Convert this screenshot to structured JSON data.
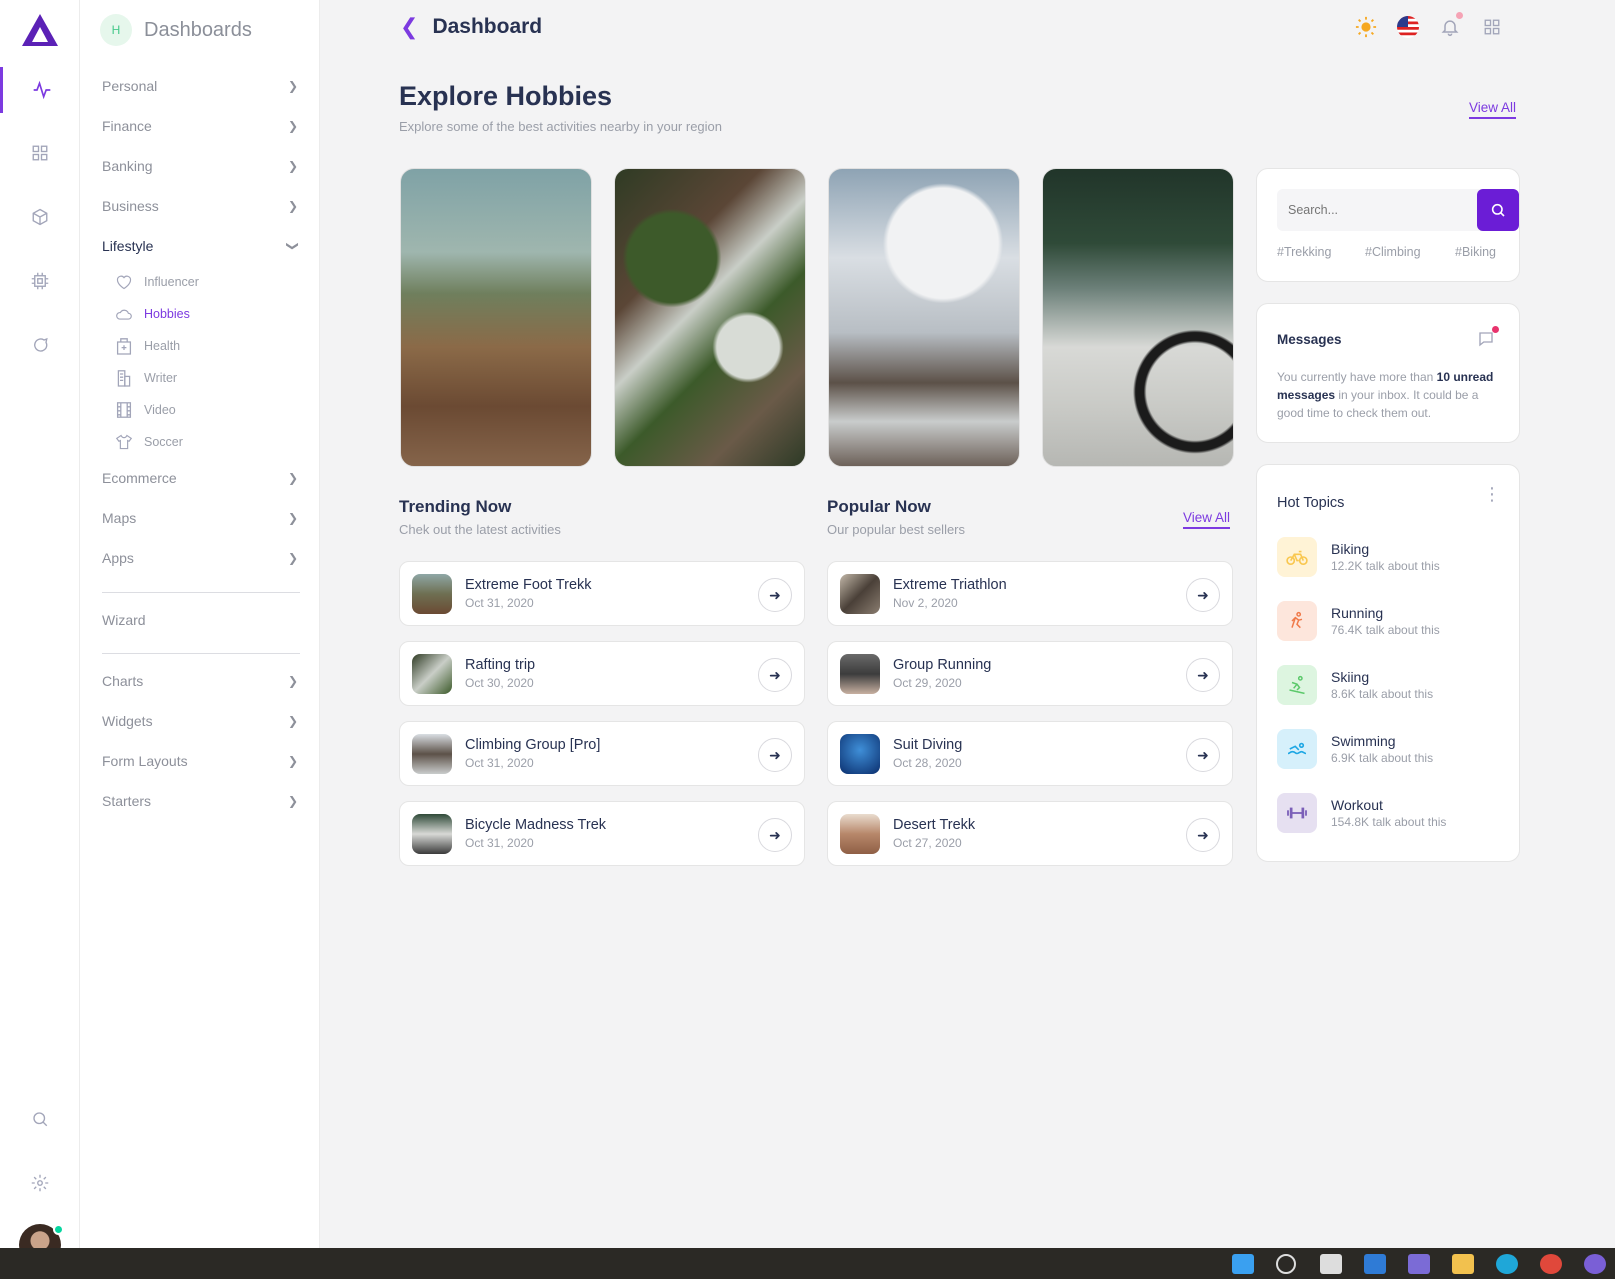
{
  "sidebar_header": {
    "avatar_letter": "H",
    "title": "Dashboards"
  },
  "menu": [
    {
      "label": "Personal"
    },
    {
      "label": "Finance"
    },
    {
      "label": "Banking"
    },
    {
      "label": "Business"
    },
    {
      "label": "Lifestyle"
    }
  ],
  "submenu": [
    {
      "label": "Influencer",
      "icon": "heart-icon"
    },
    {
      "label": "Hobbies",
      "icon": "cloud-icon"
    },
    {
      "label": "Health",
      "icon": "building-icon"
    },
    {
      "label": "Writer",
      "icon": "skyscraper-icon"
    },
    {
      "label": "Video",
      "icon": "film-icon"
    },
    {
      "label": "Soccer",
      "icon": "shirt-icon"
    }
  ],
  "menu2": [
    {
      "label": "Ecommerce"
    },
    {
      "label": "Maps"
    },
    {
      "label": "Apps"
    }
  ],
  "wizard": "Wizard",
  "menu3": [
    {
      "label": "Charts"
    },
    {
      "label": "Widgets"
    },
    {
      "label": "Form Layouts"
    },
    {
      "label": "Starters"
    }
  ],
  "topbar": {
    "title": "Dashboard"
  },
  "hero": {
    "title": "Explore Hobbies",
    "subtitle": "Explore some of the best activities nearby in your region",
    "view_all": "View All"
  },
  "trending": {
    "title": "Trending Now",
    "subtitle": "Chek out the latest activities",
    "items": [
      {
        "name": "Extreme Foot Trekk",
        "date": "Oct 31, 2020"
      },
      {
        "name": "Rafting trip",
        "date": "Oct 30, 2020"
      },
      {
        "name": "Climbing Group [Pro]",
        "date": "Oct 31, 2020"
      },
      {
        "name": "Bicycle Madness Trek",
        "date": "Oct 31, 2020"
      }
    ]
  },
  "popular": {
    "title": "Popular Now",
    "subtitle": "Our popular best sellers",
    "view_all": "View All",
    "items": [
      {
        "name": "Extreme Triathlon",
        "date": "Nov 2, 2020"
      },
      {
        "name": "Group Running",
        "date": "Oct 29, 2020"
      },
      {
        "name": "Suit Diving",
        "date": "Oct 28, 2020"
      },
      {
        "name": "Desert Trekk",
        "date": "Oct 27, 2020"
      }
    ]
  },
  "search": {
    "placeholder": "Search...",
    "tags": [
      "#Trekking",
      "#Climbing",
      "#Biking"
    ]
  },
  "messages": {
    "title": "Messages",
    "text_prefix": "You currently have more than ",
    "text_bold": "10 unread messages",
    "text_suffix": " in your inbox. It could be a good time to check them out."
  },
  "hot_topics": {
    "title": "Hot Topics",
    "items": [
      {
        "name": "Biking",
        "count": "12.2K talk about this",
        "color": "#f9c74f"
      },
      {
        "name": "Running",
        "count": "76.4K talk about this",
        "color": "#f07a4a"
      },
      {
        "name": "Skiing",
        "count": "8.6K talk about this",
        "color": "#5cc96b"
      },
      {
        "name": "Swimming",
        "count": "6.9K talk about this",
        "color": "#1ea7e4"
      },
      {
        "name": "Workout",
        "count": "154.8K talk about this",
        "color": "#7b5fb8"
      }
    ]
  },
  "colors": {
    "accent": "#7c3ae0",
    "button": "#6b1dd6"
  }
}
